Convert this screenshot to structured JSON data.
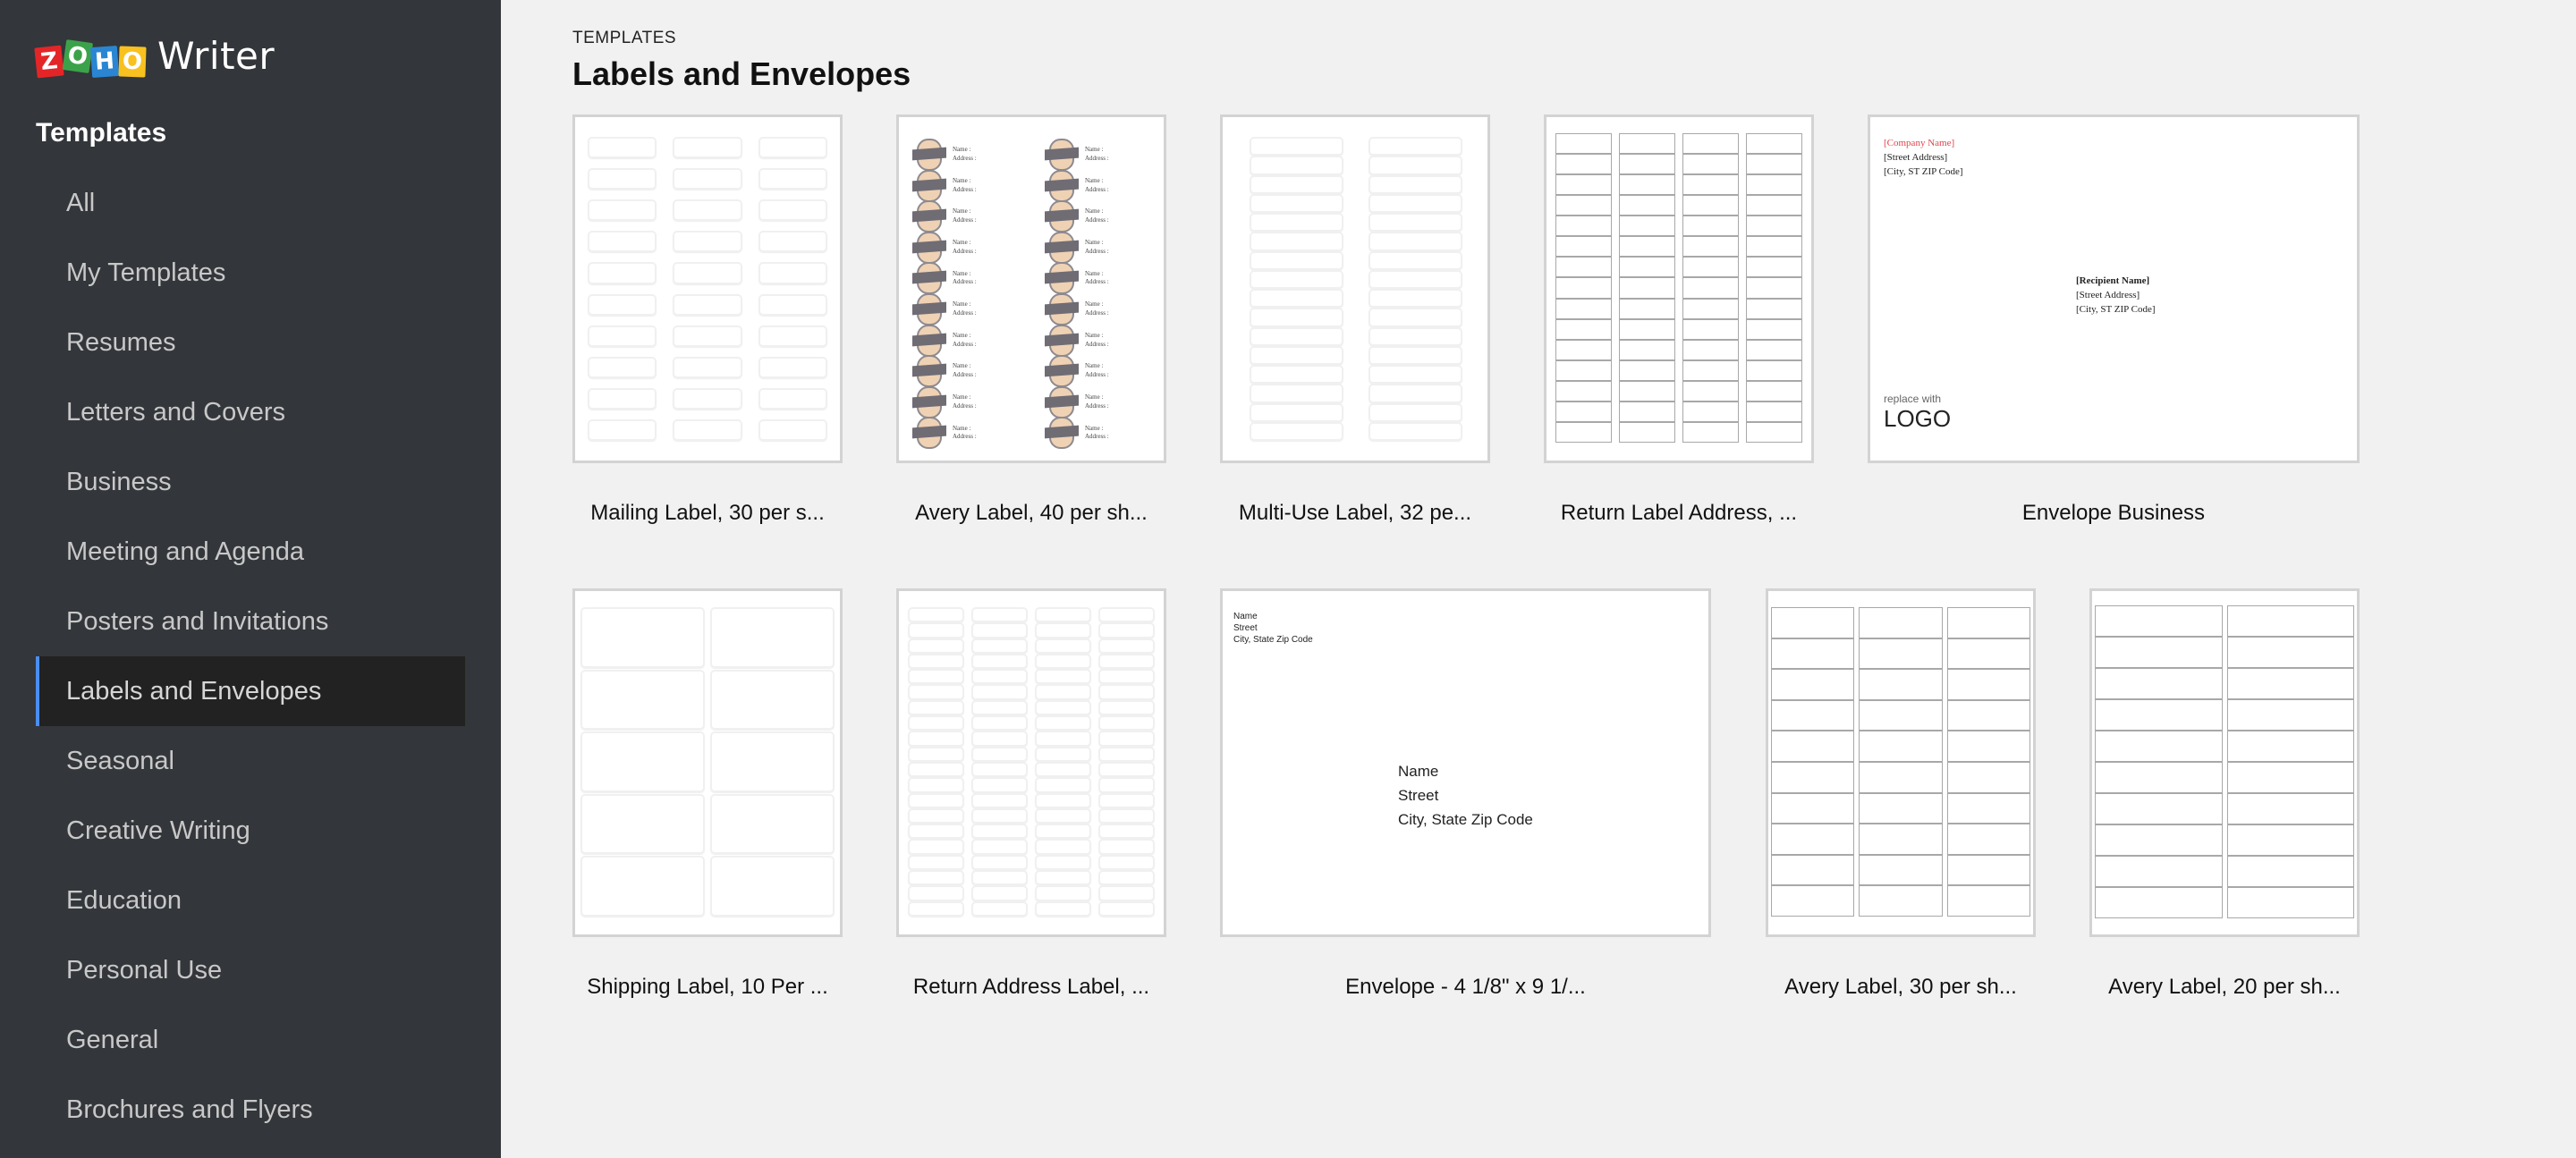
{
  "app": {
    "brand_letters": [
      "Z",
      "O",
      "H",
      "O"
    ],
    "product_name": "Writer"
  },
  "sidebar": {
    "heading": "Templates",
    "items": [
      {
        "label": "All",
        "active": false
      },
      {
        "label": "My Templates",
        "active": false
      },
      {
        "label": "Resumes",
        "active": false
      },
      {
        "label": "Letters and Covers",
        "active": false
      },
      {
        "label": "Business",
        "active": false
      },
      {
        "label": "Meeting and Agenda",
        "active": false
      },
      {
        "label": "Posters and Invitations",
        "active": false
      },
      {
        "label": "Labels and Envelopes",
        "active": true
      },
      {
        "label": "Seasonal",
        "active": false
      },
      {
        "label": "Creative Writing",
        "active": false
      },
      {
        "label": "Education",
        "active": false
      },
      {
        "label": "Personal Use",
        "active": false
      },
      {
        "label": "General",
        "active": false
      },
      {
        "label": "Brochures and Flyers",
        "active": false
      }
    ]
  },
  "main": {
    "breadcrumb": "TEMPLATES",
    "title": "Labels and Envelopes",
    "templates": [
      {
        "label": "Mailing Label, 30 per s..."
      },
      {
        "label": "Avery Label, 40 per  sh...",
        "preview": {
          "field_name": "Name :",
          "field_address": "Address :"
        }
      },
      {
        "label": "Multi-Use Label, 32 pe..."
      },
      {
        "label": "Return Label Address, ..."
      },
      {
        "label": "Envelope Business",
        "preview": {
          "sender_company": "[Company Name]",
          "sender_street": "[Street Address]",
          "sender_city": "[City, ST  ZIP Code]",
          "recipient_name": "[Recipient Name]",
          "recipient_street": "[Street Address]",
          "recipient_city": "[City, ST  ZIP Code]",
          "logo_caption": "replace with",
          "logo_text": "LOGO"
        }
      },
      {
        "label": "Shipping Label, 10 Per ..."
      },
      {
        "label": "Return Address Label, ..."
      },
      {
        "label": "Envelope - 4 1/8\" x 9 1/...",
        "preview": {
          "sender_name": "Name",
          "sender_street": "Street",
          "sender_city": "City, State  Zip Code",
          "recipient_name": "Name",
          "recipient_street": "Street",
          "recipient_city": "City, State  Zip Code"
        }
      },
      {
        "label": "Avery Label, 30 per sh..."
      },
      {
        "label": "Avery Label, 20 per sh..."
      }
    ]
  },
  "colors": {
    "sidebar_bg": "#33363a",
    "active_item_bg": "#222222",
    "active_accent": "#4a8ef0",
    "page_bg": "#f1f1f1",
    "company_name_red": "#e0454b"
  }
}
